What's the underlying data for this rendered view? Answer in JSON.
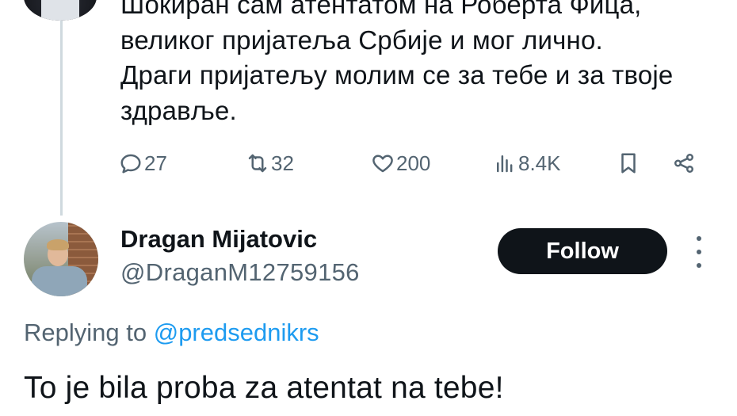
{
  "tweet": {
    "lines": [
      "Шокиран сам атентатом на Роберта Фица,",
      "великог пријатеља Србије и мог лично.",
      "Драги пријатељу молим се за тебе и за твоје",
      "здравље."
    ],
    "stats": {
      "replies": "27",
      "reposts": "32",
      "likes": "200",
      "views": "8.4K"
    }
  },
  "reply": {
    "display_name": "Dragan Mijatovic",
    "handle": "@DraganM12759156",
    "follow_label": "Follow",
    "replying_prefix": "Replying to",
    "replying_mention": "@predsednikrs",
    "text": "To je bila proba za atentat na tebe!"
  },
  "colors": {
    "text": "#0f1419",
    "secondary": "#536471",
    "link": "#1d9bf0",
    "button_bg": "#0f1419",
    "thread_line": "#cfd9de"
  },
  "icons": [
    "reply-icon",
    "repost-icon",
    "like-icon",
    "views-icon",
    "bookmark-icon",
    "share-icon",
    "more-icon"
  ]
}
